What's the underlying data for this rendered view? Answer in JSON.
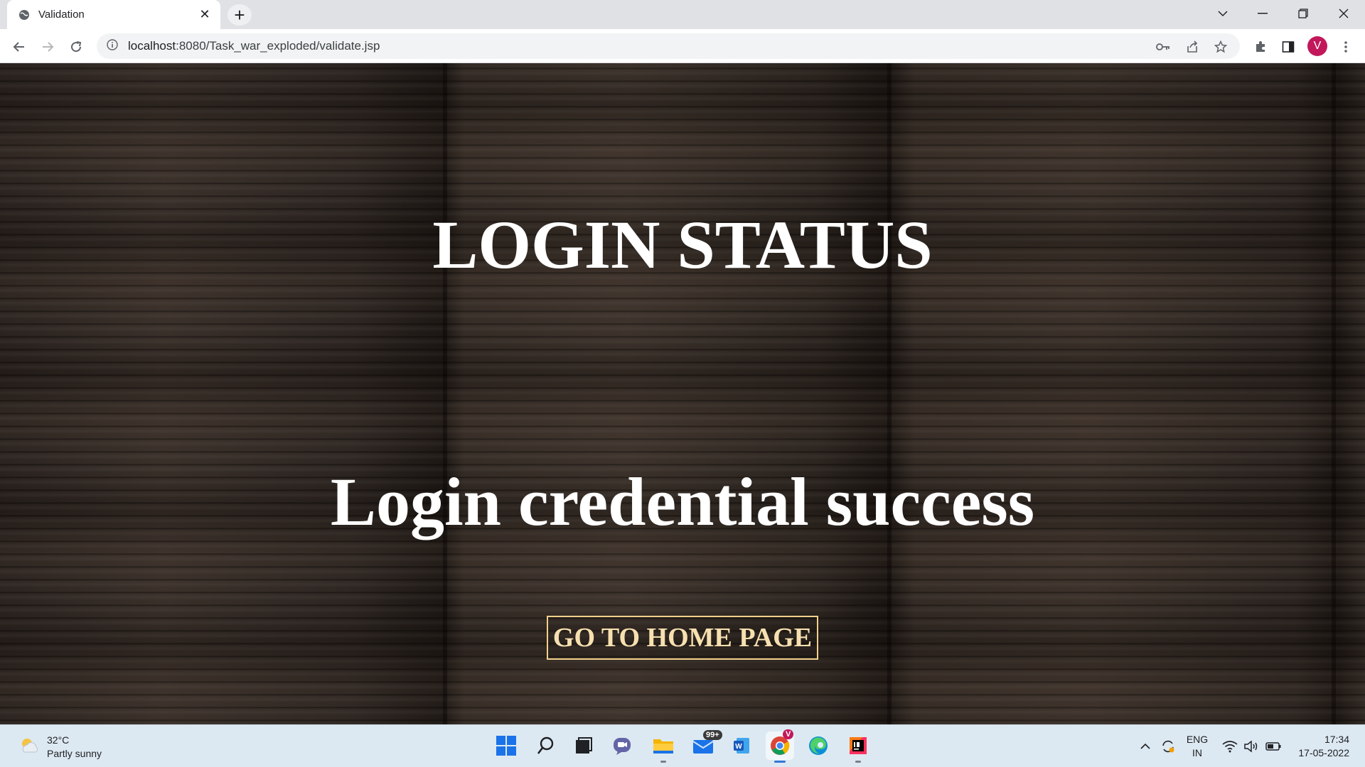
{
  "browser": {
    "tab_title": "Validation",
    "url_host": "localhost",
    "url_rest": ":8080/Task_war_exploded/validate.jsp",
    "profile_initial": "V"
  },
  "page": {
    "title": "LOGIN STATUS",
    "status_message": "Login credential success",
    "home_button_label": "GO TO HOME PAGE"
  },
  "taskbar": {
    "weather_temp": "32°C",
    "weather_desc": "Partly sunny",
    "mail_badge": "99+",
    "chrome_badge": "V",
    "lang_top": "ENG",
    "lang_bottom": "IN",
    "time": "17:34",
    "date": "17-05-2022"
  },
  "colors": {
    "accent_profile": "#c2185b",
    "button_border": "#f2d08a"
  }
}
